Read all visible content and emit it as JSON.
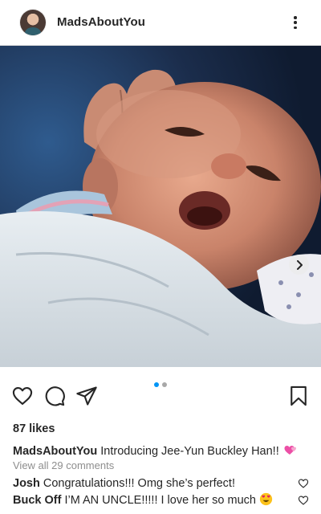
{
  "header": {
    "username": "MadsAboutYou",
    "avatar_icon": "profile-avatar",
    "more_icon": "more-vertical-icon"
  },
  "post": {
    "image_description_icon": "photo-newborn-baby",
    "next_icon": "chevron-right-icon",
    "carousel": {
      "count": 2,
      "active_index": 0
    },
    "actions": {
      "like_icon": "heart-icon",
      "comment_icon": "comment-bubble-icon",
      "share_icon": "paper-plane-icon",
      "save_icon": "bookmark-icon"
    },
    "likes": "87 likes",
    "caption": {
      "username": "MadsAboutYou",
      "text": "Introducing Jee-Yun Buckley Han!!",
      "emoji": "two-hearts-emoji"
    },
    "view_all_comments": "View all 29 comments",
    "comments": [
      {
        "username": "Josh",
        "text": "Congratulations!!! Omg she’s perfect!"
      },
      {
        "username": "Buck Off",
        "text": "I’M AN UNCLE!!!!! I love her so much",
        "emoji": "heart-eyes-emoji"
      }
    ]
  },
  "colors": {
    "accent_dot": "#0095f6",
    "inactive_dot": "#a8a8a8",
    "text": "#262626",
    "muted": "#8e8e8e"
  }
}
